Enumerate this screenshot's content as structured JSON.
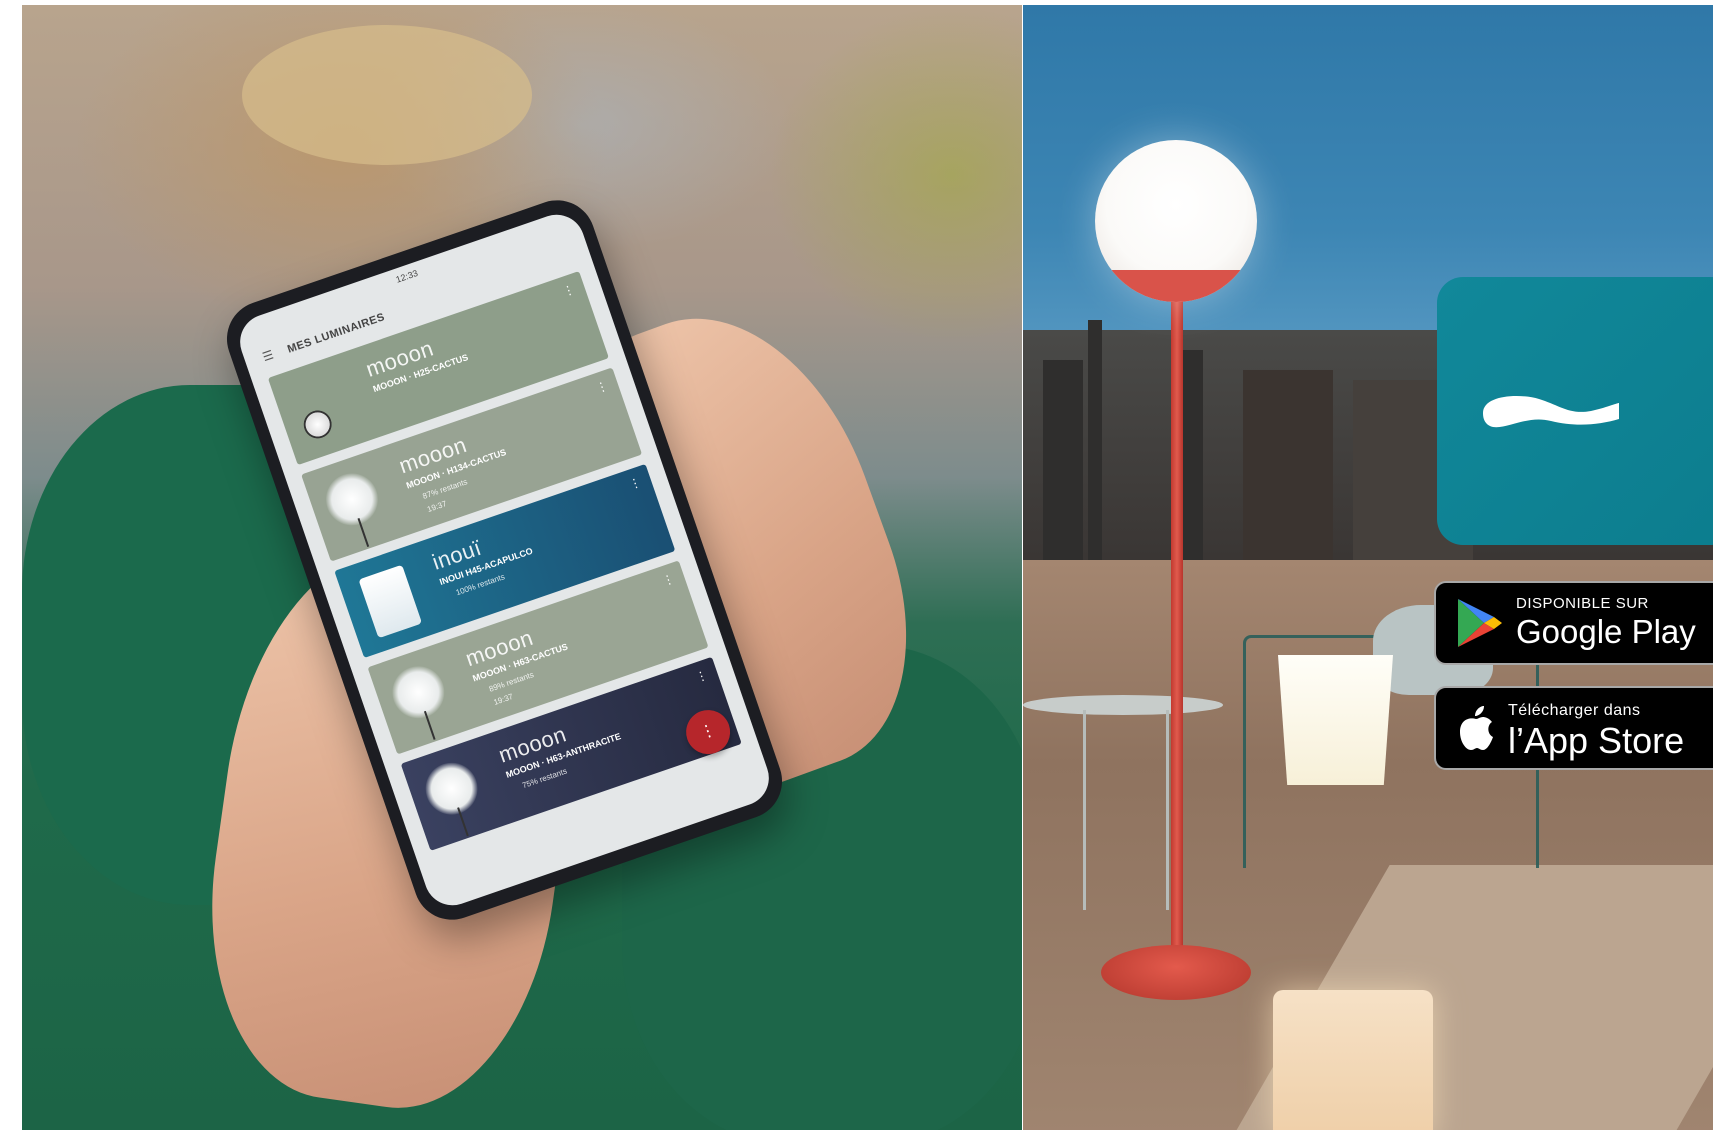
{
  "phone_app": {
    "status": "12:33",
    "title": "MES LUMINAIRES",
    "cards": [
      {
        "brand": "mooon",
        "model": "MOOON · H25-CACTUS",
        "line1": "",
        "line2": "",
        "bg": "#8e9e8a"
      },
      {
        "brand": "mooon",
        "model": "MOOON · H134-CACTUS",
        "line1": "87% restants",
        "line2": "19:37",
        "bg": "#98a393"
      },
      {
        "brand": "inouï",
        "model": "INOUI H45-ACAPULCO",
        "line1": "100% restants",
        "line2": "",
        "bg": "#1d6a88"
      },
      {
        "brand": "mooon",
        "model": "MOOON · H63-CACTUS",
        "line1": "89% restants",
        "line2": "19:37",
        "bg": "#9aa594"
      },
      {
        "brand": "mooon",
        "model": "MOOON · H63-ANTHRACITE",
        "line1": "75% restants",
        "line2": "",
        "bg": "#2e3450"
      }
    ]
  },
  "store_badges": {
    "google_small": "DISPONIBLE SUR",
    "google_big": "Google Play",
    "apple_small": "Télécharger dans",
    "apple_big": "l’App Store"
  },
  "colors": {
    "app_tile": "#11889a",
    "lamp_red": "#d9534a",
    "fab": "#b6262b"
  }
}
